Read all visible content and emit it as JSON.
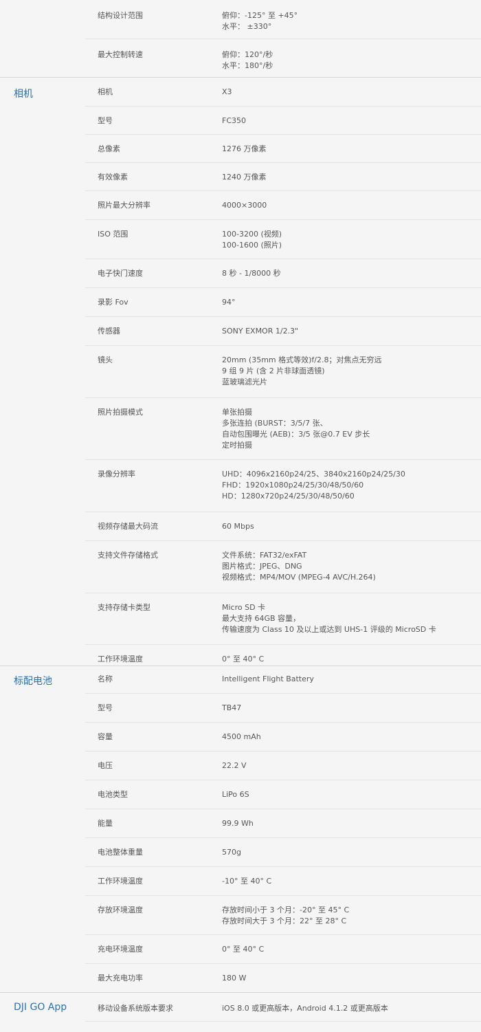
{
  "sections": [
    {
      "id": "gimbal",
      "title": "",
      "rows": [
        {
          "label": "结构设计范围",
          "values": [
            "俯仰：-125° 至 +45°",
            "水平： ±330°"
          ]
        },
        {
          "label": "最大控制转速",
          "values": [
            "俯仰：120°/秒",
            "水平：180°/秒"
          ]
        }
      ]
    },
    {
      "id": "camera",
      "title": "相机",
      "rows": [
        {
          "label": "相机",
          "values": [
            "X3"
          ]
        },
        {
          "label": "型号",
          "values": [
            "FC350"
          ]
        },
        {
          "label": "总像素",
          "values": [
            "1276 万像素"
          ]
        },
        {
          "label": "有效像素",
          "values": [
            "1240 万像素"
          ]
        },
        {
          "label": "照片最大分辨率",
          "values": [
            "4000×3000"
          ]
        },
        {
          "label": "ISO 范围",
          "values": [
            "100-3200 (视频)",
            "100-1600 (照片)"
          ]
        },
        {
          "label": "电子快门速度",
          "values": [
            "8 秒  -  1/8000 秒"
          ]
        },
        {
          "label": "录影 Fov",
          "values": [
            "94°"
          ]
        },
        {
          "label": "传感器",
          "values": [
            "SONY EXMOR 1/2.3\""
          ]
        },
        {
          "label": "镜头",
          "values": [
            "20mm (35mm 格式等效)f/2.8；对焦点无穷远",
            "9 组 9 片 (含 2 片非球面透镜)",
            "蓝玻璃滤光片"
          ]
        },
        {
          "label": "照片拍摄模式",
          "values": [
            "单张拍摄",
            "多张连拍 (BURST：3/5/7 张、",
            "自动包围曝光 (AEB)：3/5 张@0.7 EV 步长",
            "定时拍摄"
          ]
        },
        {
          "label": "录像分辨率",
          "values": [
            "UHD：4096x2160p24/25、3840x2160p24/25/30",
            "FHD：1920x1080p24/25/30/48/50/60",
            "HD：1280x720p24/25/30/48/50/60"
          ]
        },
        {
          "label": "视频存储最大码流",
          "values": [
            "60 Mbps"
          ]
        },
        {
          "label": "支持文件存储格式",
          "values": [
            "文件系统：FAT32/exFAT",
            "图片格式：JPEG、DNG",
            "视频格式：MP4/MOV (MPEG-4 AVC/H.264)"
          ]
        },
        {
          "label": "支持存储卡类型",
          "values": [
            "Micro SD 卡",
            "最大支持 64GB 容量，",
            "传输速度为 Class 10 及以上或达到 UHS-1 评级的 MicroSD 卡"
          ]
        },
        {
          "label": "工作环境温度",
          "values": [
            "0° 至 40° C"
          ]
        }
      ]
    },
    {
      "id": "battery",
      "title": "标配电池",
      "rows": [
        {
          "label": "名称",
          "values": [
            "Intelligent Flight Battery"
          ]
        },
        {
          "label": "型号",
          "values": [
            "TB47"
          ]
        },
        {
          "label": "容量",
          "values": [
            "4500 mAh"
          ]
        },
        {
          "label": "电压",
          "values": [
            "22.2 V"
          ]
        },
        {
          "label": "电池类型",
          "values": [
            "LiPo 6S"
          ]
        },
        {
          "label": "能量",
          "values": [
            "99.9 Wh"
          ]
        },
        {
          "label": "电池整体重量",
          "values": [
            "570g"
          ]
        },
        {
          "label": "工作环境温度",
          "values": [
            "-10° 至 40° C"
          ]
        },
        {
          "label": "存放环境温度",
          "values": [
            "存放时间小于 3 个月：-20° 至 45° C",
            "存放时间大于 3 个月：22° 至 28° C"
          ]
        },
        {
          "label": "充电环境温度",
          "values": [
            "0° 至 40° C"
          ]
        },
        {
          "label": "最大充电功率",
          "values": [
            "180 W"
          ]
        }
      ]
    },
    {
      "id": "app",
      "title": "DJI GO App",
      "rows": [
        {
          "label": "移动设备系统版本要求",
          "values": [
            "iOS 8.0 或更高版本，Android 4.1.2 或更高版本"
          ]
        }
      ]
    }
  ]
}
